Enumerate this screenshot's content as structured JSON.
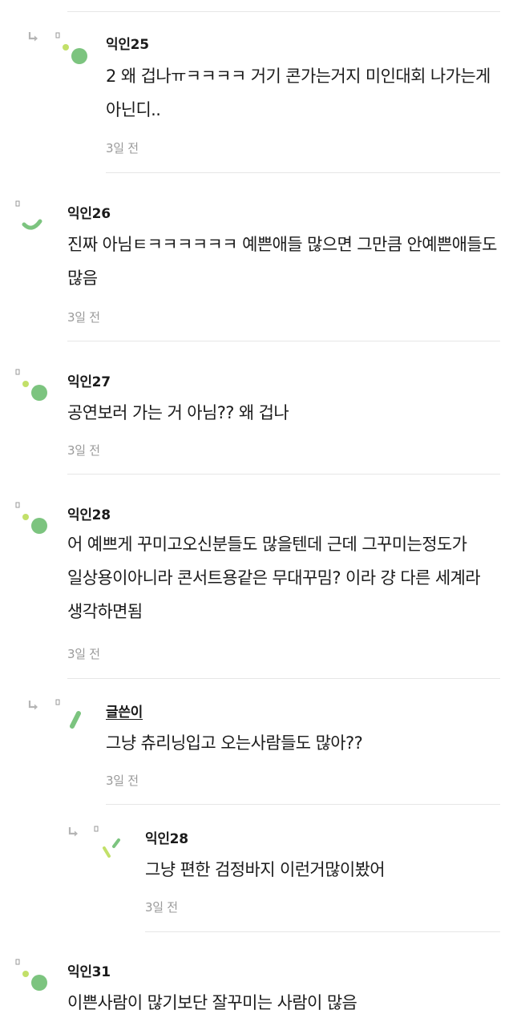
{
  "comments": [
    {
      "author": "익인25",
      "text": "2 왜 겁나ㅠㅋㅋㅋㅋ 거기 콘가는거지 미인대회 나가는게 아닌디..",
      "time": "3일 전",
      "is_reply": true
    },
    {
      "author": "익인26",
      "text": "진짜 아님ㅌㅋㅋㅋㅋㅋㅋ 예쁜애들 많으면 그만큼 안예쁜애들도 많음",
      "time": "3일 전",
      "is_reply": false
    },
    {
      "author": "익인27",
      "text": "공연보러 가는 거 아님?? 왜 겁나",
      "time": "3일 전",
      "is_reply": false
    },
    {
      "author": "익인28",
      "text": "어 예쁘게 꾸미고오신분들도 많을텐데 근데 그꾸미는정도가 일상용이아니라 콘서트용같은 무대꾸밈? 이라 걍 다른 세계라 생각하면됨",
      "time": "3일 전",
      "is_reply": false
    },
    {
      "author": "글쓴이",
      "text": "그냥 츄리닝입고 오는사람들도 많아??",
      "time": "3일 전",
      "is_reply": true
    },
    {
      "author": "익인28",
      "text": "그냥 편한 검정바지 이런거많이봤어",
      "time": "3일 전",
      "is_reply": true
    },
    {
      "author": "익인31",
      "text": "이쁜사람이 많기보단 잘꾸미는 사람이 많음",
      "time": "",
      "is_reply": false
    }
  ],
  "colors": {
    "avatar_green": "#7cc47f",
    "avatar_lime": "#c2e069",
    "avatar_dark_green": "#5aab5e"
  },
  "icons": {
    "reply_arrow": "reply-arrow-icon"
  }
}
